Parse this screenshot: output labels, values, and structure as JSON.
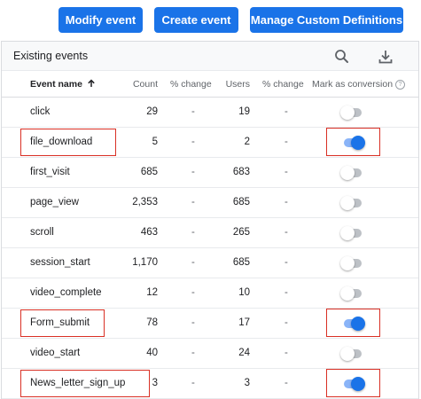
{
  "buttons": {
    "modify": "Modify event",
    "create": "Create event",
    "manage": "Manage Custom Definitions"
  },
  "card": {
    "title": "Existing events",
    "icons": [
      "search-icon",
      "download-icon"
    ]
  },
  "columns": {
    "event_name": "Event name",
    "count": "Count",
    "count_change": "% change",
    "users": "Users",
    "users_change": "% change",
    "conversion": "Mark as conversion",
    "sort_icon": "arrow-up-icon",
    "help_icon": "help-icon"
  },
  "rows": [
    {
      "name": "click",
      "count": "29",
      "count_change": "-",
      "users": "19",
      "users_change": "-",
      "conversion": false
    },
    {
      "name": "file_download",
      "count": "5",
      "count_change": "-",
      "users": "2",
      "users_change": "-",
      "conversion": true
    },
    {
      "name": "first_visit",
      "count": "685",
      "count_change": "-",
      "users": "683",
      "users_change": "-",
      "conversion": false
    },
    {
      "name": "page_view",
      "count": "2,353",
      "count_change": "-",
      "users": "685",
      "users_change": "-",
      "conversion": false
    },
    {
      "name": "scroll",
      "count": "463",
      "count_change": "-",
      "users": "265",
      "users_change": "-",
      "conversion": false
    },
    {
      "name": "session_start",
      "count": "1,170",
      "count_change": "-",
      "users": "685",
      "users_change": "-",
      "conversion": false
    },
    {
      "name": "video_complete",
      "count": "12",
      "count_change": "-",
      "users": "10",
      "users_change": "-",
      "conversion": false
    },
    {
      "name": "Form_submit",
      "count": "78",
      "count_change": "-",
      "users": "17",
      "users_change": "-",
      "conversion": true
    },
    {
      "name": "video_start",
      "count": "40",
      "count_change": "-",
      "users": "24",
      "users_change": "-",
      "conversion": false
    },
    {
      "name": "News_letter_sign_up",
      "count": "3",
      "count_change": "-",
      "users": "3",
      "users_change": "-",
      "conversion": true
    }
  ],
  "colors": {
    "primary": "#1a73e8",
    "toggle_track_on": "#8ab4f8",
    "toggle_track_off": "#bdc1c6",
    "highlight": "#d93025"
  }
}
